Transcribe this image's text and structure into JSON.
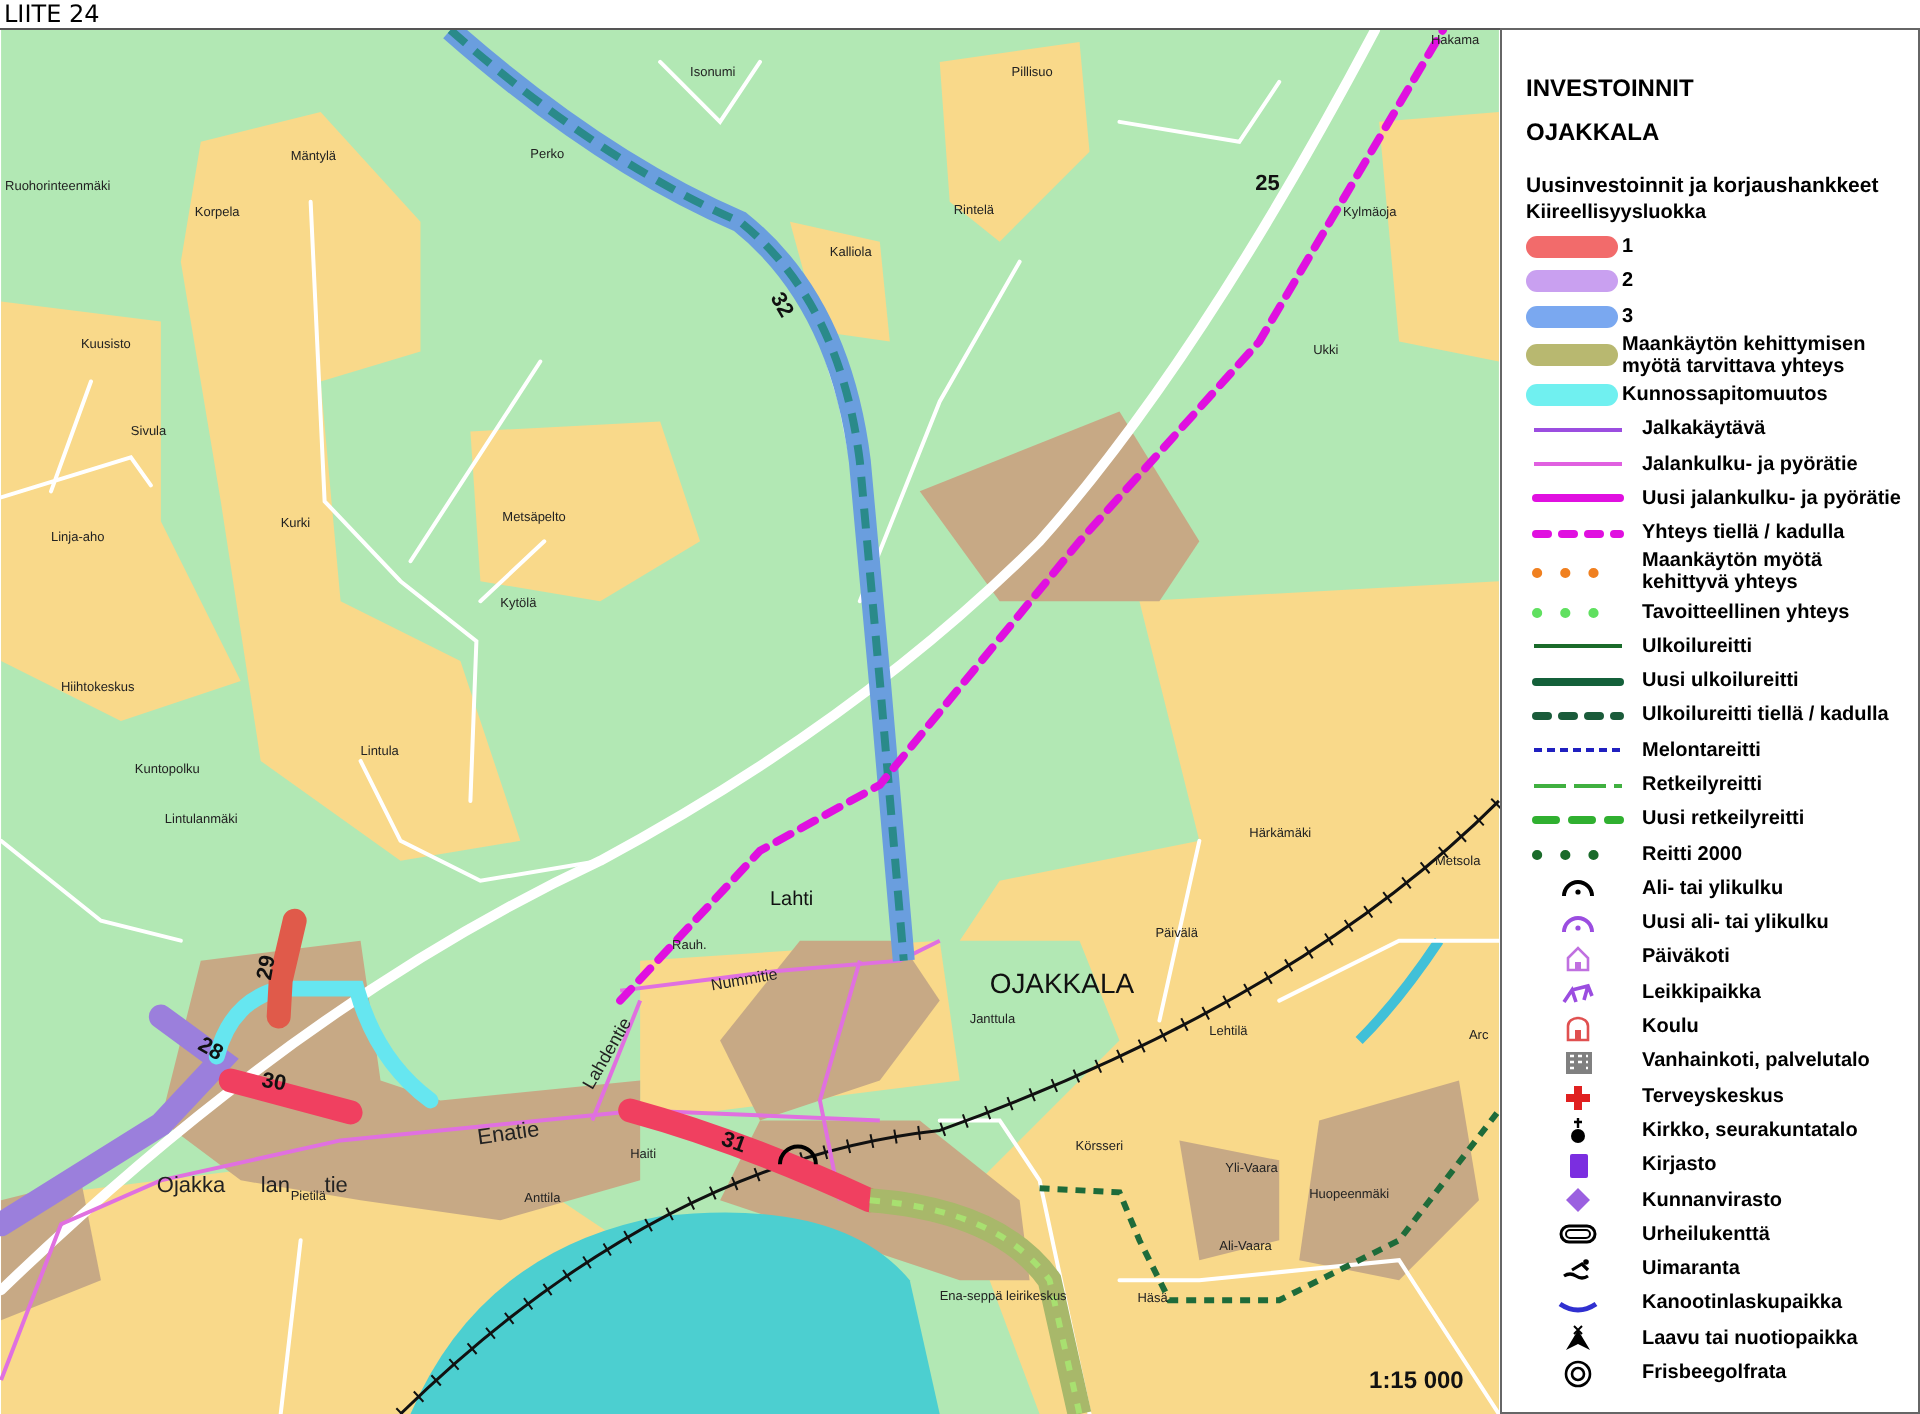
{
  "header": {
    "title": "LIITE 24"
  },
  "map": {
    "place_names": [
      "Isonumi",
      "Pillisuo",
      "Hakama",
      "Mäntylä",
      "Ruohorinteenmäki",
      "Korpela",
      "Perko",
      "Rintelä",
      "Kalliola",
      "Kylmäoja",
      "Ukki",
      "Kuusisto",
      "Sivula",
      "Linja-aho",
      "Kurki",
      "Metsäpelto",
      "Kytölä",
      "Hiihtokeskus",
      "Lintula",
      "Kuntopolku",
      "Lintulanmäki",
      "Härkämäki",
      "Metsola",
      "Rauh.",
      "Päivälä",
      "Janttula",
      "Lehtilä",
      "Körsseri",
      "Yli-Vaara",
      "Huopeenmäki",
      "Ali-Vaara",
      "Häsä",
      "Pietilä",
      "Anttila",
      "Haiti",
      "Arc",
      "Ena-seppä leirikeskus"
    ],
    "town_names": [
      "OJAKKALA",
      "Lahti"
    ],
    "street_names": [
      "Enatie",
      "Ojakka",
      "lan",
      "tie",
      "Lahdentie",
      "Nummitie"
    ],
    "route_numbers": [
      "25",
      "32",
      "29",
      "28",
      "30",
      "31"
    ],
    "scale": "1:15 000"
  },
  "legend": {
    "title": [
      "INVESTOINNIT",
      "OJAKKALA"
    ],
    "subtitle": "Uusinvestoinnit ja korjaushankkeet",
    "caption": "Kiireellisyysluokka",
    "items": [
      {
        "kind": "band",
        "color": "#f26b6b",
        "label": "1"
      },
      {
        "kind": "band",
        "color": "#c9a0f0",
        "label": "2"
      },
      {
        "kind": "band",
        "color": "#7aa8f0",
        "label": "3"
      },
      {
        "kind": "band",
        "color": "#b8b870",
        "label": "Maankäytön kehittymisen myötä tarvittava yhteys"
      },
      {
        "kind": "band",
        "color": "#70f0f0",
        "label": "Kunnossapitomuutos"
      },
      {
        "kind": "line",
        "color": "#9b4de0",
        "label": "Jalkakäytävä"
      },
      {
        "kind": "line",
        "color": "#e060e0",
        "label": "Jalankulku- ja pyörätie"
      },
      {
        "kind": "thick",
        "color": "#e010e0",
        "label": "Uusi jalankulku- ja pyörätie"
      },
      {
        "kind": "dashed",
        "color": "#e010e0",
        "label": "Yhteys tiellä / kadulla"
      },
      {
        "kind": "dots",
        "color": "#f08020",
        "label": "Maankäytön myötä kehittyvä yhteys"
      },
      {
        "kind": "dots",
        "color": "#60e060",
        "label": "Tavoitteellinen yhteys"
      },
      {
        "kind": "line",
        "color": "#1a6b2a",
        "label": "Ulkoilureitti"
      },
      {
        "kind": "thick",
        "color": "#14603a",
        "label": "Uusi ulkoilureitti"
      },
      {
        "kind": "dashed",
        "color": "#1a5b3a",
        "label": "Ulkoilureitti tiellä / kadulla"
      },
      {
        "kind": "fine-dash",
        "color": "#2020c0",
        "label": "Melontareitti"
      },
      {
        "kind": "long-dash",
        "color": "#40b040",
        "label": "Retkeilyreitti"
      },
      {
        "kind": "thick-long-dash",
        "color": "#30b030",
        "label": "Uusi retkeilyreitti"
      },
      {
        "kind": "dots",
        "color": "#1a6b2a",
        "label": "Reitti 2000"
      },
      {
        "kind": "arch",
        "color": "#000000",
        "label": "Ali- tai ylikulku"
      },
      {
        "kind": "arch",
        "color": "#9b4de0",
        "label": "Uusi ali- tai ylikulku"
      },
      {
        "kind": "house",
        "color": "#c070e0",
        "label": "Päiväkoti"
      },
      {
        "kind": "playground",
        "color": "#9b4de0",
        "label": "Leikkipaikka"
      },
      {
        "kind": "school",
        "color": "#e05050",
        "label": "Koulu"
      },
      {
        "kind": "building",
        "color": "#808080",
        "label": "Vanhainkoti, palvelutalo"
      },
      {
        "kind": "cross",
        "color": "#e02020",
        "label": "Terveyskeskus"
      },
      {
        "kind": "church",
        "color": "#000000",
        "label": "Kirkko, seurakuntatalo"
      },
      {
        "kind": "book",
        "color": "#7b2ee0",
        "label": "Kirjasto"
      },
      {
        "kind": "diamond",
        "color": "#9b60e0",
        "label": "Kunnanvirasto"
      },
      {
        "kind": "field",
        "color": "#000000",
        "label": "Urheilukenttä"
      },
      {
        "kind": "swimmer",
        "color": "#000000",
        "label": "Uimaranta"
      },
      {
        "kind": "canoe",
        "color": "#3030d0",
        "label": "Kanootinlaskupaikka"
      },
      {
        "kind": "tent",
        "color": "#000000",
        "label": "Laavu tai nuotiopaikka"
      },
      {
        "kind": "target",
        "color": "#000000",
        "label": "Frisbeegolfrata"
      }
    ]
  }
}
